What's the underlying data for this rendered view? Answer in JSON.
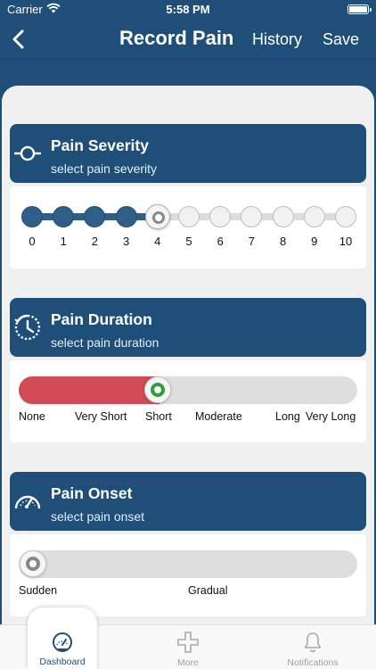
{
  "status_bar": {
    "carrier": "Carrier",
    "time": "5:58 PM"
  },
  "nav": {
    "title": "Record Pain",
    "history_label": "History",
    "save_label": "Save"
  },
  "severity": {
    "title": "Pain Severity",
    "subtitle": "select pain severity",
    "scale": [
      "0",
      "1",
      "2",
      "3",
      "4",
      "5",
      "6",
      "7",
      "8",
      "9",
      "10"
    ],
    "selected": 4
  },
  "duration": {
    "title": "Pain Duration",
    "subtitle": "select pain duration",
    "options": [
      "None",
      "Very Short",
      "Short",
      "Moderate",
      "Long",
      "Very Long"
    ],
    "selected": "Short",
    "fill_color": "#d04b55"
  },
  "onset": {
    "title": "Pain Onset",
    "subtitle": "select pain onset",
    "options": [
      "Sudden",
      "Gradual"
    ],
    "selected": "Sudden"
  },
  "tabbar": {
    "items": [
      {
        "label": "Dashboard",
        "icon": "dashboard-gauge-icon",
        "active": true
      },
      {
        "label": "More",
        "icon": "plus-icon",
        "active": false
      },
      {
        "label": "Notifications",
        "icon": "bell-icon",
        "active": false
      }
    ]
  },
  "colors": {
    "primary": "#1f4e79",
    "accent_red": "#d04b55",
    "selected_green": "#2e9e3a"
  }
}
